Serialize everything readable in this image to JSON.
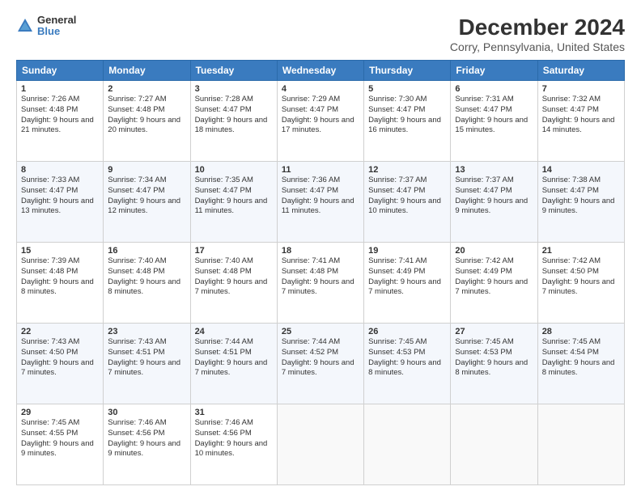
{
  "logo": {
    "line1": "General",
    "line2": "Blue"
  },
  "title": "December 2024",
  "subtitle": "Corry, Pennsylvania, United States",
  "headers": [
    "Sunday",
    "Monday",
    "Tuesday",
    "Wednesday",
    "Thursday",
    "Friday",
    "Saturday"
  ],
  "weeks": [
    [
      {
        "day": "1",
        "sunrise": "7:26 AM",
        "sunset": "4:48 PM",
        "daylight": "9 hours and 21 minutes."
      },
      {
        "day": "2",
        "sunrise": "7:27 AM",
        "sunset": "4:48 PM",
        "daylight": "9 hours and 20 minutes."
      },
      {
        "day": "3",
        "sunrise": "7:28 AM",
        "sunset": "4:47 PM",
        "daylight": "9 hours and 18 minutes."
      },
      {
        "day": "4",
        "sunrise": "7:29 AM",
        "sunset": "4:47 PM",
        "daylight": "9 hours and 17 minutes."
      },
      {
        "day": "5",
        "sunrise": "7:30 AM",
        "sunset": "4:47 PM",
        "daylight": "9 hours and 16 minutes."
      },
      {
        "day": "6",
        "sunrise": "7:31 AM",
        "sunset": "4:47 PM",
        "daylight": "9 hours and 15 minutes."
      },
      {
        "day": "7",
        "sunrise": "7:32 AM",
        "sunset": "4:47 PM",
        "daylight": "9 hours and 14 minutes."
      }
    ],
    [
      {
        "day": "8",
        "sunrise": "7:33 AM",
        "sunset": "4:47 PM",
        "daylight": "9 hours and 13 minutes."
      },
      {
        "day": "9",
        "sunrise": "7:34 AM",
        "sunset": "4:47 PM",
        "daylight": "9 hours and 12 minutes."
      },
      {
        "day": "10",
        "sunrise": "7:35 AM",
        "sunset": "4:47 PM",
        "daylight": "9 hours and 11 minutes."
      },
      {
        "day": "11",
        "sunrise": "7:36 AM",
        "sunset": "4:47 PM",
        "daylight": "9 hours and 11 minutes."
      },
      {
        "day": "12",
        "sunrise": "7:37 AM",
        "sunset": "4:47 PM",
        "daylight": "9 hours and 10 minutes."
      },
      {
        "day": "13",
        "sunrise": "7:37 AM",
        "sunset": "4:47 PM",
        "daylight": "9 hours and 9 minutes."
      },
      {
        "day": "14",
        "sunrise": "7:38 AM",
        "sunset": "4:47 PM",
        "daylight": "9 hours and 9 minutes."
      }
    ],
    [
      {
        "day": "15",
        "sunrise": "7:39 AM",
        "sunset": "4:48 PM",
        "daylight": "9 hours and 8 minutes."
      },
      {
        "day": "16",
        "sunrise": "7:40 AM",
        "sunset": "4:48 PM",
        "daylight": "9 hours and 8 minutes."
      },
      {
        "day": "17",
        "sunrise": "7:40 AM",
        "sunset": "4:48 PM",
        "daylight": "9 hours and 7 minutes."
      },
      {
        "day": "18",
        "sunrise": "7:41 AM",
        "sunset": "4:48 PM",
        "daylight": "9 hours and 7 minutes."
      },
      {
        "day": "19",
        "sunrise": "7:41 AM",
        "sunset": "4:49 PM",
        "daylight": "9 hours and 7 minutes."
      },
      {
        "day": "20",
        "sunrise": "7:42 AM",
        "sunset": "4:49 PM",
        "daylight": "9 hours and 7 minutes."
      },
      {
        "day": "21",
        "sunrise": "7:42 AM",
        "sunset": "4:50 PM",
        "daylight": "9 hours and 7 minutes."
      }
    ],
    [
      {
        "day": "22",
        "sunrise": "7:43 AM",
        "sunset": "4:50 PM",
        "daylight": "9 hours and 7 minutes."
      },
      {
        "day": "23",
        "sunrise": "7:43 AM",
        "sunset": "4:51 PM",
        "daylight": "9 hours and 7 minutes."
      },
      {
        "day": "24",
        "sunrise": "7:44 AM",
        "sunset": "4:51 PM",
        "daylight": "9 hours and 7 minutes."
      },
      {
        "day": "25",
        "sunrise": "7:44 AM",
        "sunset": "4:52 PM",
        "daylight": "9 hours and 7 minutes."
      },
      {
        "day": "26",
        "sunrise": "7:45 AM",
        "sunset": "4:53 PM",
        "daylight": "9 hours and 8 minutes."
      },
      {
        "day": "27",
        "sunrise": "7:45 AM",
        "sunset": "4:53 PM",
        "daylight": "9 hours and 8 minutes."
      },
      {
        "day": "28",
        "sunrise": "7:45 AM",
        "sunset": "4:54 PM",
        "daylight": "9 hours and 8 minutes."
      }
    ],
    [
      {
        "day": "29",
        "sunrise": "7:45 AM",
        "sunset": "4:55 PM",
        "daylight": "9 hours and 9 minutes."
      },
      {
        "day": "30",
        "sunrise": "7:46 AM",
        "sunset": "4:56 PM",
        "daylight": "9 hours and 9 minutes."
      },
      {
        "day": "31",
        "sunrise": "7:46 AM",
        "sunset": "4:56 PM",
        "daylight": "9 hours and 10 minutes."
      },
      null,
      null,
      null,
      null
    ]
  ]
}
